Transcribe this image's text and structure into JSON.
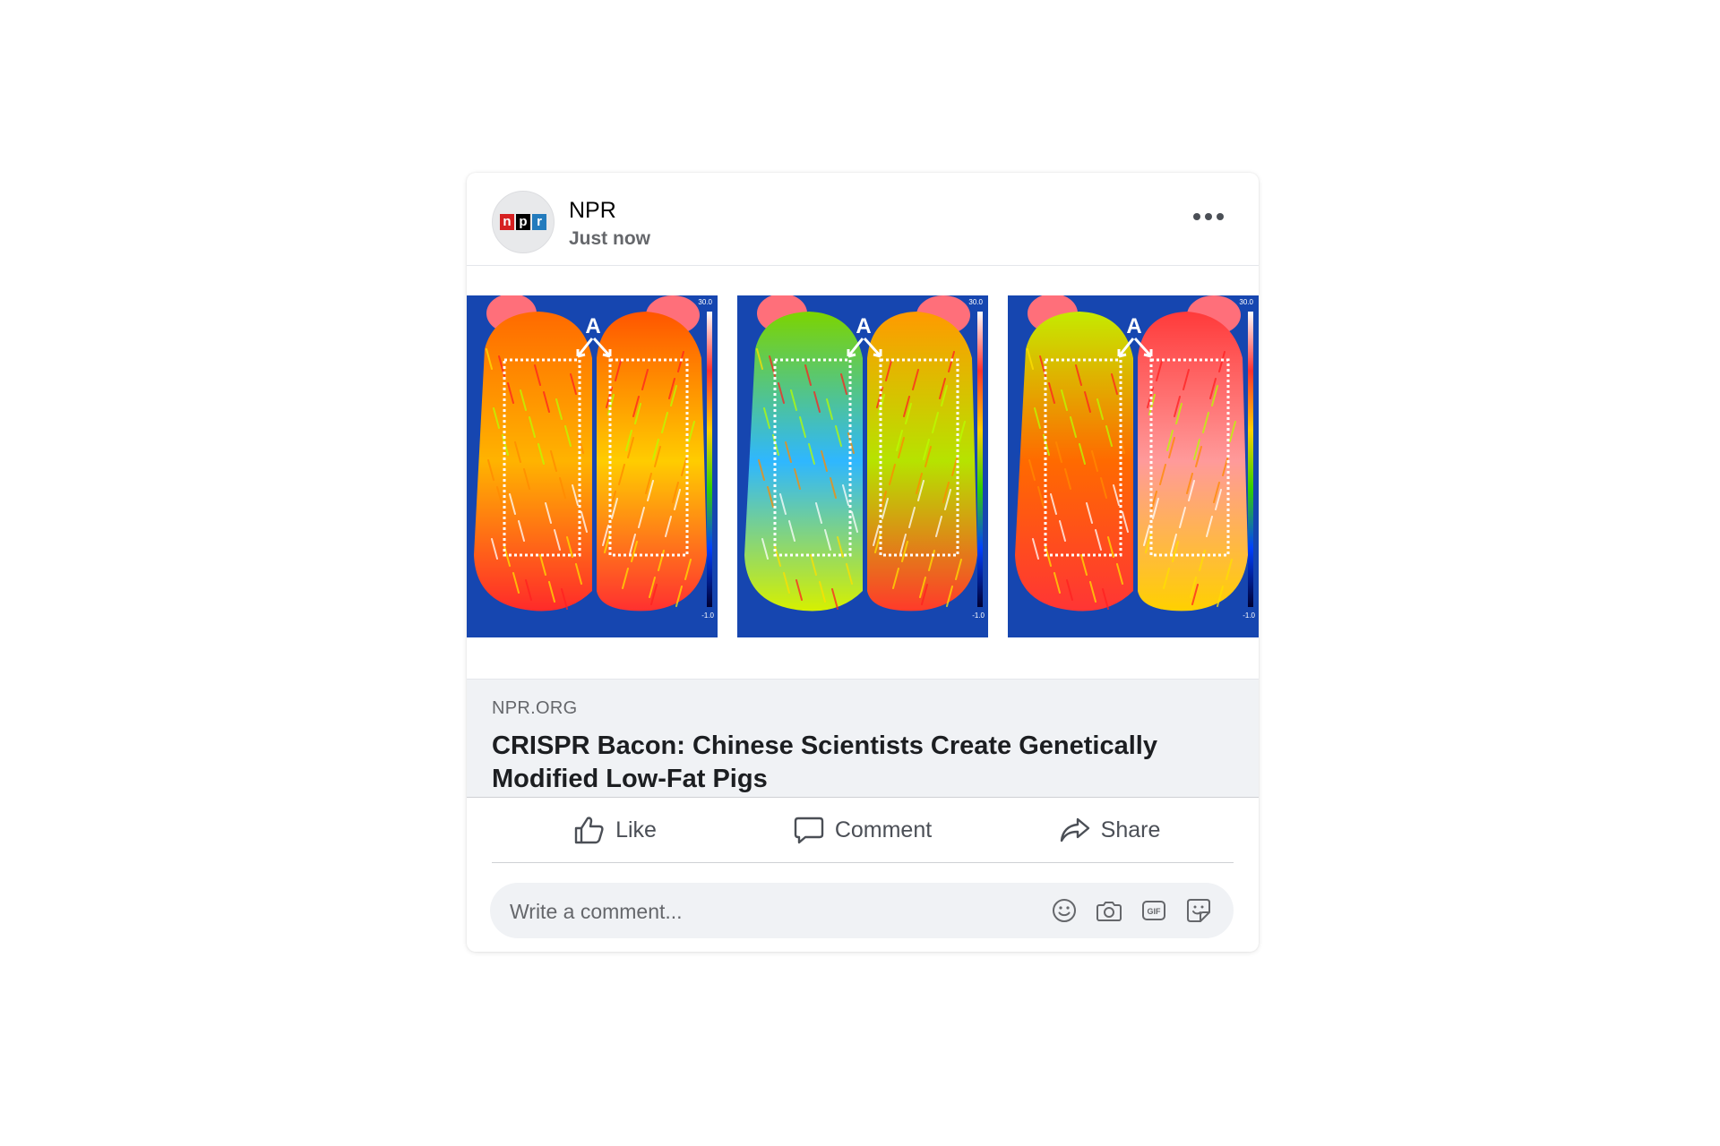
{
  "post": {
    "author": "NPR",
    "timestamp": "Just now",
    "avatar_logo_letters": [
      "n",
      "p",
      "r"
    ]
  },
  "images": [
    {
      "label": "A",
      "temp_high": "30.0",
      "temp_low": "-1.0"
    },
    {
      "label": "A",
      "temp_high": "30.0",
      "temp_low": "-1.0"
    },
    {
      "label": "A",
      "temp_high": "30.0",
      "temp_low": "-1.0"
    }
  ],
  "link": {
    "domain": "NPR.ORG",
    "title": "CRISPR Bacon: Chinese Scientists Create Genetically Modified Low-Fat Pigs"
  },
  "actions": {
    "like": "Like",
    "comment": "Comment",
    "share": "Share"
  },
  "comment_box": {
    "placeholder": "Write a comment..."
  },
  "colors": {
    "text_primary": "#050505",
    "text_secondary": "#65676b",
    "input_bg": "#f0f2f5",
    "npr_red": "#d62021",
    "npr_black": "#000000",
    "npr_blue": "#237bbd"
  },
  "icons": {
    "more": "more-horizontal-icon",
    "like": "thumbs-up-icon",
    "comment": "speech-bubble-icon",
    "share": "share-arrow-icon",
    "emoji": "smiley-icon",
    "camera": "camera-icon",
    "gif": "gif-icon",
    "sticker": "sticker-icon"
  }
}
